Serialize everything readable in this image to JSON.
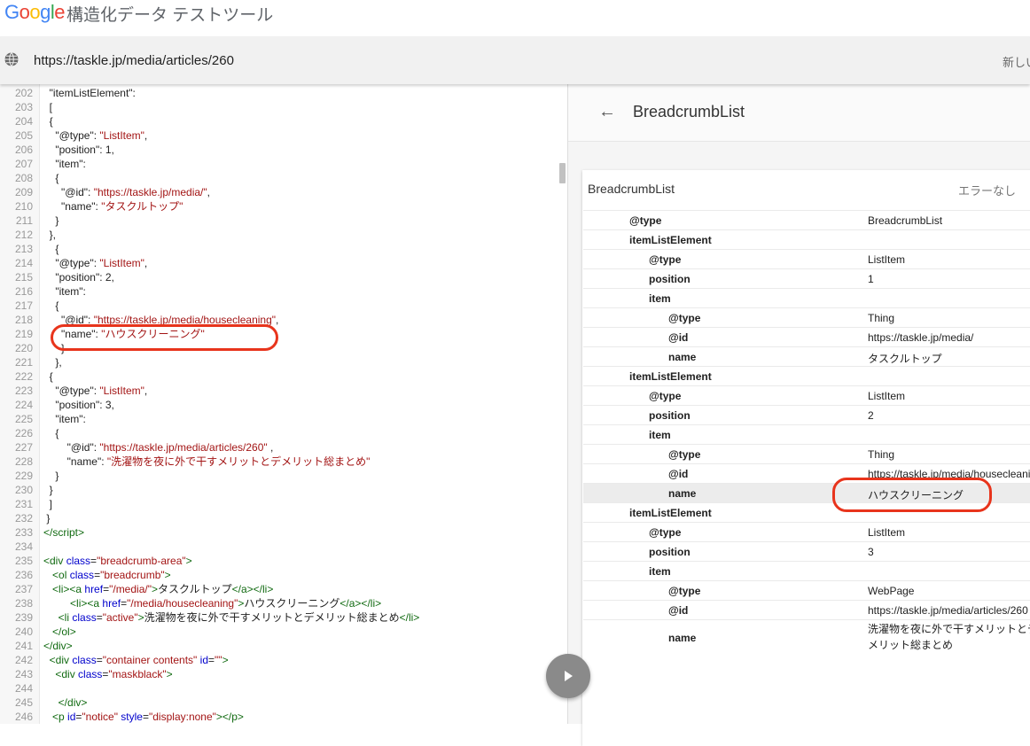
{
  "header": {
    "logo": "Google",
    "title": "構造化データ テストツール"
  },
  "urlbar": {
    "url": "https://taskle.jp/media/articles/260",
    "new_test": "新しい"
  },
  "colors": {
    "google_blue": "#4285f4",
    "google_red": "#ea4335",
    "google_yellow": "#fbbc05",
    "google_green": "#34a853",
    "highlight_ring": "#e8341c"
  },
  "code_lines": [
    {
      "ln": "202",
      "html": "  \"itemListElement\":"
    },
    {
      "ln": "203",
      "html": "  ["
    },
    {
      "ln": "204",
      "html": "  {"
    },
    {
      "ln": "205",
      "html": "    \"@type\": <span class=\"s\">\"ListItem\"</span>,"
    },
    {
      "ln": "206",
      "html": "    \"position\": 1,"
    },
    {
      "ln": "207",
      "html": "    \"item\":"
    },
    {
      "ln": "208",
      "html": "    {"
    },
    {
      "ln": "209",
      "html": "      \"@id\": <span class=\"s\">\"https://taskle.jp/media/\"</span>,"
    },
    {
      "ln": "210",
      "html": "      \"name\": <span class=\"s\">\"タスクルトップ\"</span>"
    },
    {
      "ln": "211",
      "html": "    }"
    },
    {
      "ln": "212",
      "html": "  },"
    },
    {
      "ln": "213",
      "html": "    {"
    },
    {
      "ln": "214",
      "html": "    \"@type\": <span class=\"s\">\"ListItem\"</span>,"
    },
    {
      "ln": "215",
      "html": "    \"position\": 2,"
    },
    {
      "ln": "216",
      "html": "    \"item\":"
    },
    {
      "ln": "217",
      "html": "    {"
    },
    {
      "ln": "218",
      "html": "      \"@id\": <span class=\"s\">\"https://taskle.jp/media/housecleaning\"</span>,"
    },
    {
      "ln": "219",
      "html": "      \"name\": <span class=\"s\">\"ハウスクリーニング\"</span>"
    },
    {
      "ln": "220",
      "html": "      }"
    },
    {
      "ln": "221",
      "html": "    },"
    },
    {
      "ln": "222",
      "html": "  {"
    },
    {
      "ln": "223",
      "html": "    \"@type\": <span class=\"s\">\"ListItem\"</span>,"
    },
    {
      "ln": "224",
      "html": "    \"position\": 3,"
    },
    {
      "ln": "225",
      "html": "    \"item\":"
    },
    {
      "ln": "226",
      "html": "    {"
    },
    {
      "ln": "227",
      "html": "        \"@id\": <span class=\"s\">\"https://taskle.jp/media/articles/260\"</span> ,"
    },
    {
      "ln": "228",
      "html": "        \"name\": <span class=\"s\">\"洗濯物を夜に外で干すメリットとデメリット総まとめ\"</span>"
    },
    {
      "ln": "229",
      "html": "    }"
    },
    {
      "ln": "230",
      "html": "  }"
    },
    {
      "ln": "231",
      "html": "  ]"
    },
    {
      "ln": "232",
      "html": " }"
    },
    {
      "ln": "233",
      "html": "<span class=\"t\">&lt;/script&gt;</span>"
    },
    {
      "ln": "234",
      "html": ""
    },
    {
      "ln": "235",
      "html": "<span class=\"t\">&lt;div</span> <span class=\"a\">class</span>=<span class=\"s\">\"breadcrumb-area\"</span><span class=\"t\">&gt;</span>"
    },
    {
      "ln": "236",
      "html": "   <span class=\"t\">&lt;ol</span> <span class=\"a\">class</span>=<span class=\"s\">\"breadcrumb\"</span><span class=\"t\">&gt;</span>"
    },
    {
      "ln": "237",
      "html": "   <span class=\"t\">&lt;li&gt;&lt;a</span> <span class=\"a\">href</span>=<span class=\"s\">\"/media/\"</span><span class=\"t\">&gt;</span>タスクルトップ<span class=\"t\">&lt;/a&gt;&lt;/li&gt;</span>"
    },
    {
      "ln": "238",
      "html": "         <span class=\"t\">&lt;li&gt;&lt;a</span> <span class=\"a\">href</span>=<span class=\"s\">\"/media/housecleaning\"</span><span class=\"t\">&gt;</span>ハウスクリーニング<span class=\"t\">&lt;/a&gt;&lt;/li&gt;</span>"
    },
    {
      "ln": "239",
      "html": "     <span class=\"t\">&lt;li</span> <span class=\"a\">class</span>=<span class=\"s\">\"active\"</span><span class=\"t\">&gt;</span>洗濯物を夜に外で干すメリットとデメリット総まとめ<span class=\"t\">&lt;/li&gt;</span>"
    },
    {
      "ln": "240",
      "html": "   <span class=\"t\">&lt;/ol&gt;</span>"
    },
    {
      "ln": "241",
      "html": "<span class=\"t\">&lt;/div&gt;</span>"
    },
    {
      "ln": "242",
      "html": "  <span class=\"t\">&lt;div</span> <span class=\"a\">class</span>=<span class=\"s\">\"container contents\"</span> <span class=\"a\">id</span>=<span class=\"s\">\"\"</span><span class=\"t\">&gt;</span>"
    },
    {
      "ln": "243",
      "html": "    <span class=\"t\">&lt;div</span> <span class=\"a\">class</span>=<span class=\"s\">\"maskblack\"</span><span class=\"t\">&gt;</span>"
    },
    {
      "ln": "244",
      "html": ""
    },
    {
      "ln": "245",
      "html": "     <span class=\"t\">&lt;/div&gt;</span>"
    },
    {
      "ln": "246",
      "html": "   <span class=\"t\">&lt;p</span> <span class=\"a\">id</span>=<span class=\"s\">\"notice\"</span> <span class=\"a\">style</span>=<span class=\"s\">\"display:none\"</span><span class=\"t\">&gt;&lt;/p&gt;</span>"
    }
  ],
  "result": {
    "back_icon": "arrow-back-icon",
    "title": "BreadcrumbList",
    "card_title": "BreadcrumbList",
    "status": "エラーなし",
    "rows": [
      {
        "key": "@type",
        "value": "BreadcrumbList",
        "level": 0
      },
      {
        "key": "itemListElement",
        "value": "",
        "level": 0
      },
      {
        "key": "@type",
        "value": "ListItem",
        "level": 1
      },
      {
        "key": "position",
        "value": "1",
        "level": 1
      },
      {
        "key": "item",
        "value": "",
        "level": 1
      },
      {
        "key": "@type",
        "value": "Thing",
        "level": 2
      },
      {
        "key": "@id",
        "value": "https://taskle.jp/media/",
        "level": 2
      },
      {
        "key": "name",
        "value": "タスクルトップ",
        "level": 2
      },
      {
        "key": "itemListElement",
        "value": "",
        "level": 0
      },
      {
        "key": "@type",
        "value": "ListItem",
        "level": 1
      },
      {
        "key": "position",
        "value": "2",
        "level": 1
      },
      {
        "key": "item",
        "value": "",
        "level": 1
      },
      {
        "key": "@type",
        "value": "Thing",
        "level": 2
      },
      {
        "key": "@id",
        "value": "https://taskle.jp/media/housecleaning",
        "level": 2
      },
      {
        "key": "name",
        "value": "ハウスクリーニング",
        "level": 2,
        "highlight": true
      },
      {
        "key": "itemListElement",
        "value": "",
        "level": 0
      },
      {
        "key": "@type",
        "value": "ListItem",
        "level": 1
      },
      {
        "key": "position",
        "value": "3",
        "level": 1
      },
      {
        "key": "item",
        "value": "",
        "level": 1
      },
      {
        "key": "@type",
        "value": "WebPage",
        "level": 2
      },
      {
        "key": "@id",
        "value": "https://taskle.jp/media/articles/260",
        "level": 2
      },
      {
        "key": "name",
        "value": "洗濯物を夜に外で干すメリットとデメリット総まとめ",
        "level": 2,
        "tall": true
      }
    ]
  },
  "play_icon": "play-icon"
}
